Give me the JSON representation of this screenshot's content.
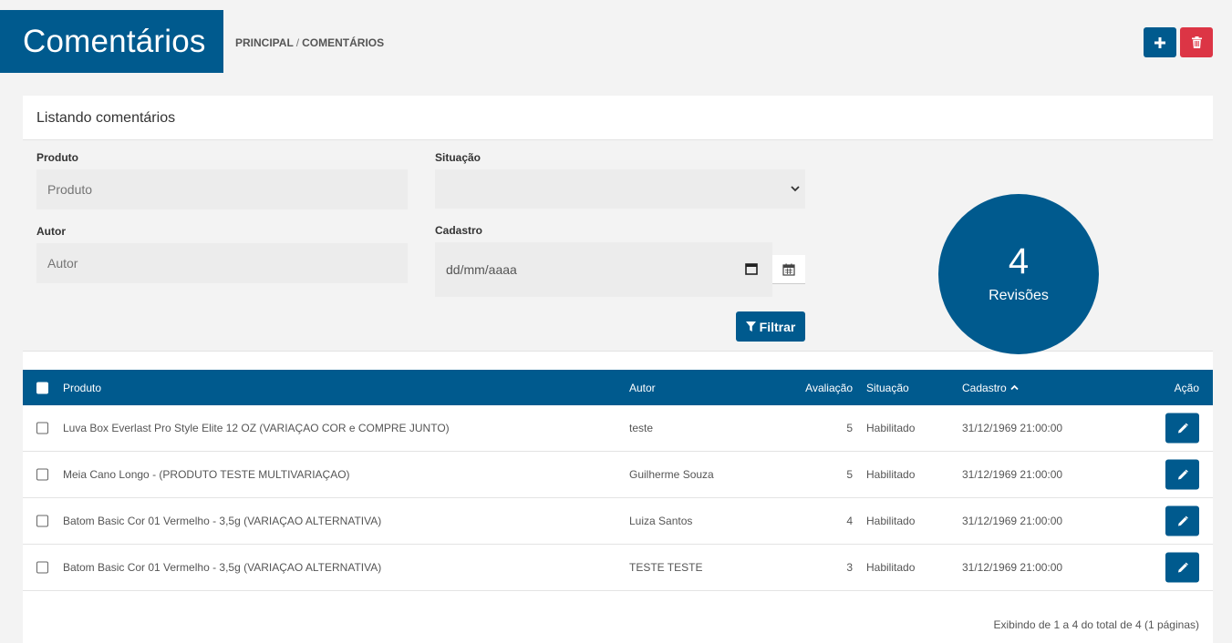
{
  "header": {
    "title": "Comentários",
    "breadcrumb": [
      "PRINCIPAL",
      "COMENTÁRIOS"
    ],
    "separator": "/"
  },
  "panel": {
    "title": "Listando comentários"
  },
  "filters": {
    "produto": {
      "label": "Produto",
      "placeholder": "Produto"
    },
    "situacao": {
      "label": "Situação",
      "value": ""
    },
    "autor": {
      "label": "Autor",
      "placeholder": "Autor"
    },
    "cadastro": {
      "label": "Cadastro",
      "placeholder": "dd/mm/aaaa"
    },
    "filter_button": "Filtrar"
  },
  "summary": {
    "count": "4",
    "label": "Revisões"
  },
  "table": {
    "columns": [
      "Produto",
      "Autor",
      "Avaliação",
      "Situação",
      "Cadastro",
      "Ação"
    ],
    "rows": [
      {
        "produto": "Luva Box Everlast Pro Style Elite 12 OZ (VARIAÇAO COR e COMPRE JUNTO)",
        "autor": "teste",
        "avaliacao": "5",
        "situacao": "Habilitado",
        "cadastro": "31/12/1969 21:00:00"
      },
      {
        "produto": "Meia Cano Longo - (PRODUTO TESTE MULTIVARIAÇAO)",
        "autor": "Guilherme Souza",
        "avaliacao": "5",
        "situacao": "Habilitado",
        "cadastro": "31/12/1969 21:00:00"
      },
      {
        "produto": "Batom Basic Cor 01 Vermelho - 3,5g (VARIAÇAO ALTERNATIVA)",
        "autor": "Luiza Santos",
        "avaliacao": "4",
        "situacao": "Habilitado",
        "cadastro": "31/12/1969 21:00:00"
      },
      {
        "produto": "Batom Basic Cor 01 Vermelho - 3,5g (VARIAÇAO ALTERNATIVA)",
        "autor": "TESTE TESTE",
        "avaliacao": "3",
        "situacao": "Habilitado",
        "cadastro": "31/12/1969 21:00:00"
      }
    ]
  },
  "pagination": {
    "info": "Exibindo de 1 a 4 do total de 4 (1 páginas)"
  },
  "colors": {
    "primary": "#005a8e",
    "danger": "#dc3545"
  },
  "icons": {
    "add": "plus-icon",
    "delete": "trash-icon",
    "filter": "filter-icon",
    "edit": "pencil-icon",
    "calendar": "calendar-icon",
    "sort": "chevron-up-icon"
  }
}
